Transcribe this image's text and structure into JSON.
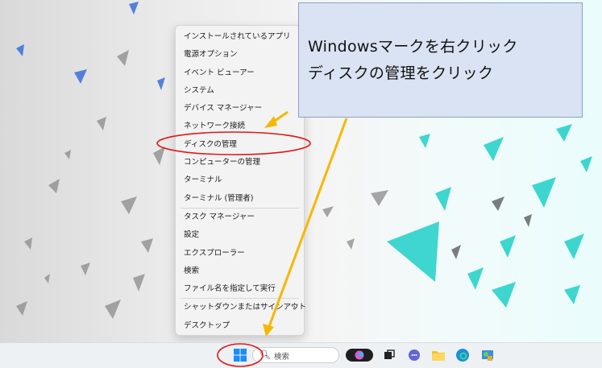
{
  "context_menu": {
    "items": [
      {
        "label": "インストールされているアプリ",
        "submenu": false
      },
      {
        "label": "電源オプション",
        "submenu": false
      },
      {
        "label": "イベント ビューアー",
        "submenu": false
      },
      {
        "label": "システム",
        "submenu": false
      },
      {
        "label": "デバイス マネージャー",
        "submenu": false
      },
      {
        "label": "ネットワーク接続",
        "submenu": false
      },
      {
        "label": "ディスクの管理",
        "submenu": false
      },
      {
        "label": "コンピューターの管理",
        "submenu": false
      },
      {
        "label": "ターミナル",
        "submenu": false
      },
      {
        "label": "ターミナル (管理者)",
        "submenu": false
      },
      {
        "label": "タスク マネージャー",
        "submenu": false
      },
      {
        "label": "設定",
        "submenu": false
      },
      {
        "label": "エクスプローラー",
        "submenu": false
      },
      {
        "label": "検索",
        "submenu": false
      },
      {
        "label": "ファイル名を指定して実行",
        "submenu": false
      },
      {
        "label": "シャットダウンまたはサインアウト",
        "submenu": true
      },
      {
        "label": "デスクトップ",
        "submenu": false
      }
    ]
  },
  "callout": {
    "line1": "Windowsマークを右クリック",
    "line2": "ディスクの管理をクリック"
  },
  "taskbar": {
    "search_placeholder": "検索",
    "icons": [
      "windows-start-icon",
      "copilot-icon",
      "task-view-icon",
      "teams-chat-icon",
      "file-explorer-icon",
      "edge-icon",
      "control-panel-icon"
    ]
  },
  "colors": {
    "annotation_red": "#e01818",
    "arrow_yellow": "#f5b800",
    "callout_bg": "#dae3f3",
    "windows_blue": "#1a8cff"
  }
}
